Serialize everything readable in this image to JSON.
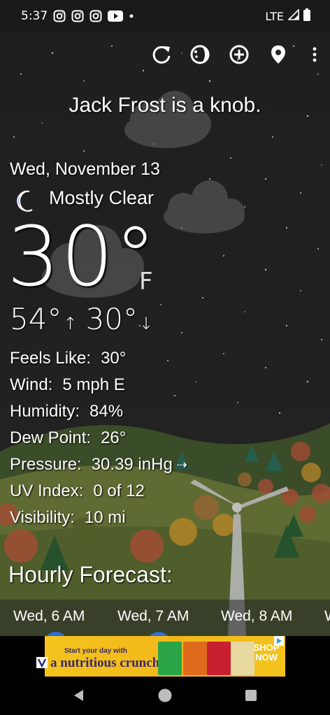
{
  "status_bar": {
    "time": "5:37",
    "network": "LTE",
    "notification_icons": [
      "instagram-icon",
      "instagram-icon",
      "instagram-icon",
      "youtube-icon",
      "dot-icon"
    ]
  },
  "toolbar": {
    "icons": [
      "refresh-icon",
      "theme-icon",
      "add-location-icon",
      "location-pin-icon",
      "more-vert-icon"
    ]
  },
  "headline": "Jack Frost is a knob.",
  "current": {
    "date": "Wed, November 13",
    "condition": "Mostly Clear",
    "condition_icon": "moon-icon",
    "temperature": "30°",
    "unit": "F",
    "high": "54°",
    "low": "30°"
  },
  "details": {
    "feels_like_label": "Feels Like:",
    "feels_like_value": "30°",
    "wind_label": "Wind:",
    "wind_value": "5 mph E",
    "humidity_label": "Humidity:",
    "humidity_value": "84%",
    "dew_point_label": "Dew Point:",
    "dew_point_value": "26°",
    "pressure_label": "Pressure:",
    "pressure_value": "30.39 inHg",
    "uv_label": "UV Index:",
    "uv_value": "0 of 12",
    "visibility_label": "Visibility:",
    "visibility_value": "10 mi"
  },
  "hourly": {
    "title": "Hourly Forecast:",
    "items": [
      {
        "label": "Wed, 6 AM"
      },
      {
        "label": "Wed, 7 AM"
      },
      {
        "label": "Wed, 8 AM"
      },
      {
        "label": "W"
      }
    ]
  },
  "ad": {
    "line1": "Start your day with",
    "line2": "a nutritious crunch.",
    "cta": "SHOP NOW",
    "brand_colors": [
      "#f4c31c",
      "#3b2a6a",
      "#c8202f",
      "#2ba548",
      "#e06a1b"
    ]
  },
  "nav": {
    "icons": [
      "back-icon",
      "home-icon",
      "recents-icon"
    ]
  },
  "colors": {
    "sky": "#242424",
    "hills": "#6b7a3a",
    "accent_blue": "#2f6fd6"
  }
}
